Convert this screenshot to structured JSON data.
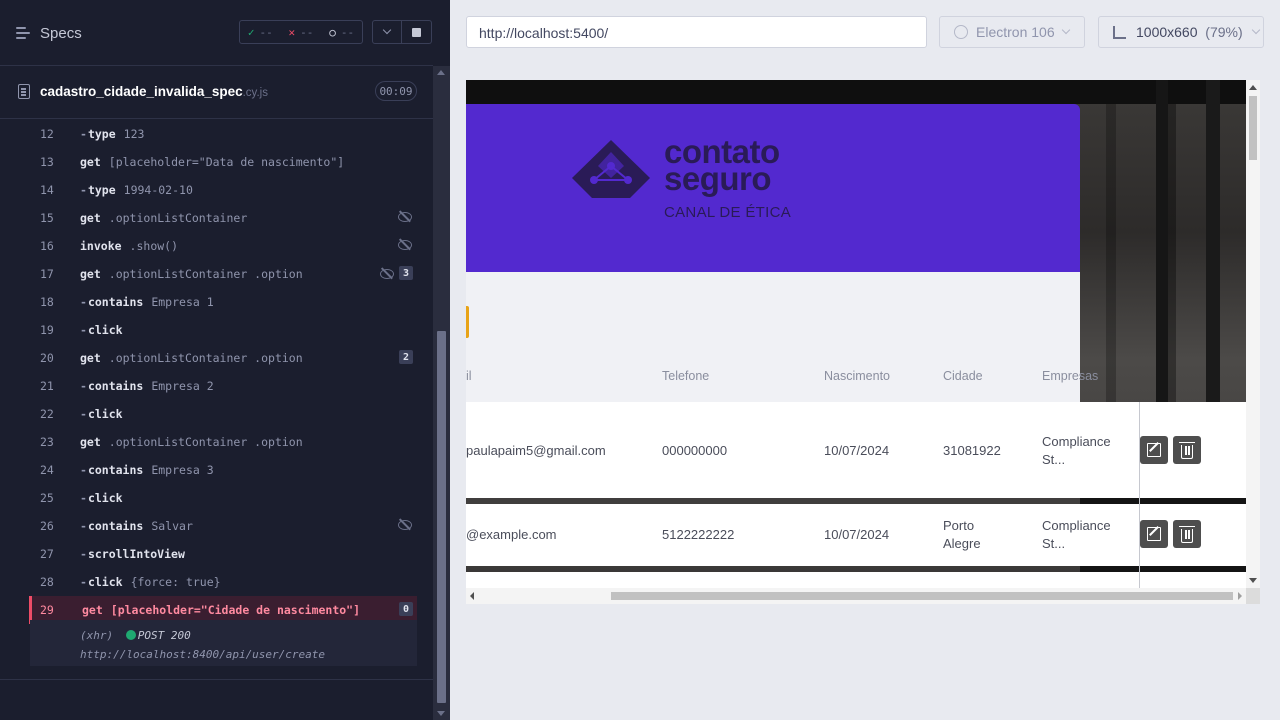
{
  "reporter": {
    "header": {
      "title": "Specs",
      "stats": {
        "passed": "--",
        "failed": "--",
        "pending": "--"
      }
    },
    "spec": {
      "name": "cadastro_cidade_invalida_spec",
      "ext": ".cy.js",
      "duration": "00:09"
    },
    "commands": [
      {
        "num": "12",
        "name": "type",
        "child": true,
        "msg": "123",
        "hidden": false,
        "badge": ""
      },
      {
        "num": "13",
        "name": "get",
        "child": false,
        "msg": "[placeholder=\"Data de nascimento\"]",
        "hidden": false,
        "badge": ""
      },
      {
        "num": "14",
        "name": "type",
        "child": true,
        "msg": "1994-02-10",
        "hidden": false,
        "badge": ""
      },
      {
        "num": "15",
        "name": "get",
        "child": false,
        "msg": ".optionListContainer",
        "hidden": true,
        "badge": ""
      },
      {
        "num": "16",
        "name": "invoke",
        "child": false,
        "msg": ".show()",
        "hidden": true,
        "badge": ""
      },
      {
        "num": "17",
        "name": "get",
        "child": false,
        "msg": ".optionListContainer .option",
        "hidden": true,
        "badge": "3"
      },
      {
        "num": "18",
        "name": "contains",
        "child": true,
        "msg": "Empresa 1",
        "hidden": false,
        "badge": ""
      },
      {
        "num": "19",
        "name": "click",
        "child": true,
        "msg": "",
        "hidden": false,
        "badge": ""
      },
      {
        "num": "20",
        "name": "get",
        "child": false,
        "msg": ".optionListContainer .option",
        "hidden": false,
        "badge": "2"
      },
      {
        "num": "21",
        "name": "contains",
        "child": true,
        "msg": "Empresa 2",
        "hidden": false,
        "badge": ""
      },
      {
        "num": "22",
        "name": "click",
        "child": true,
        "msg": "",
        "hidden": false,
        "badge": ""
      },
      {
        "num": "23",
        "name": "get",
        "child": false,
        "msg": ".optionListContainer .option",
        "hidden": false,
        "badge": ""
      },
      {
        "num": "24",
        "name": "contains",
        "child": true,
        "msg": "Empresa 3",
        "hidden": false,
        "badge": ""
      },
      {
        "num": "25",
        "name": "click",
        "child": true,
        "msg": "",
        "hidden": false,
        "badge": ""
      },
      {
        "num": "26",
        "name": "contains",
        "child": true,
        "msg": "Salvar",
        "hidden": true,
        "badge": ""
      },
      {
        "num": "27",
        "name": "scrollIntoView",
        "child": true,
        "msg": "",
        "hidden": false,
        "badge": ""
      },
      {
        "num": "28",
        "name": "click",
        "child": true,
        "msg": "{force: true}",
        "hidden": false,
        "badge": ""
      },
      {
        "num": "29",
        "name": "get",
        "child": false,
        "msg": "[placeholder=\"Cidade de nascimento\"]",
        "hidden": false,
        "badge": "0",
        "failed": true
      }
    ],
    "xhr": {
      "type": "(xhr)",
      "method_status": "POST 200",
      "url": "http://localhost:8400/api/user/create"
    }
  },
  "aut": {
    "url": "http://localhost:5400/",
    "browser": "Electron 106",
    "viewport": "1000x660",
    "zoom": "(79%)",
    "logo": {
      "line1": "contato",
      "line2": "seguro",
      "sub": "CANAL DE ÉTICA"
    },
    "table": {
      "headers": [
        "il",
        "Telefone",
        "Nascimento",
        "Cidade",
        "Empresas"
      ],
      "rows": [
        {
          "email": "paulapaim5@gmail.com",
          "phone": "000000000",
          "birth": "10/07/2024",
          "city": "31081922",
          "company": "Compliance St..."
        },
        {
          "email": "@example.com",
          "phone": "5122222222",
          "birth": "10/07/2024",
          "city": "Porto Alegre",
          "company": "Compliance St..."
        }
      ]
    }
  },
  "colors": {
    "accent_purple": "#5329cf",
    "fail": "#ed4c67",
    "pass": "#1fa971"
  }
}
